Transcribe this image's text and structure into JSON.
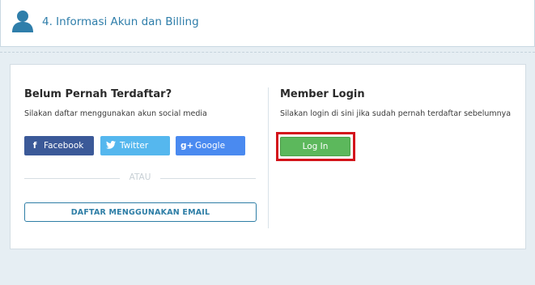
{
  "header": {
    "title": "4. Informasi Akun dan Billing",
    "icon": "user-icon"
  },
  "register": {
    "heading": "Belum Pernah Terdaftar?",
    "subtext": "Silakan daftar menggunakan akun social media",
    "facebook_label": "Facebook",
    "twitter_label": "Twitter",
    "google_label": "Google",
    "separator": "ATAU",
    "email_button": "DAFTAR MENGGUNAKAN EMAIL"
  },
  "login": {
    "heading": "Member Login",
    "subtext": "Silakan login di sini jika sudah pernah terdaftar sebelumnya",
    "button": "Log In"
  },
  "colors": {
    "accent": "#2f7eaa",
    "facebook": "#3b5998",
    "twitter": "#55b7ee",
    "google": "#4a8af0",
    "login": "#5cb85c",
    "highlight": "#d3141b"
  }
}
